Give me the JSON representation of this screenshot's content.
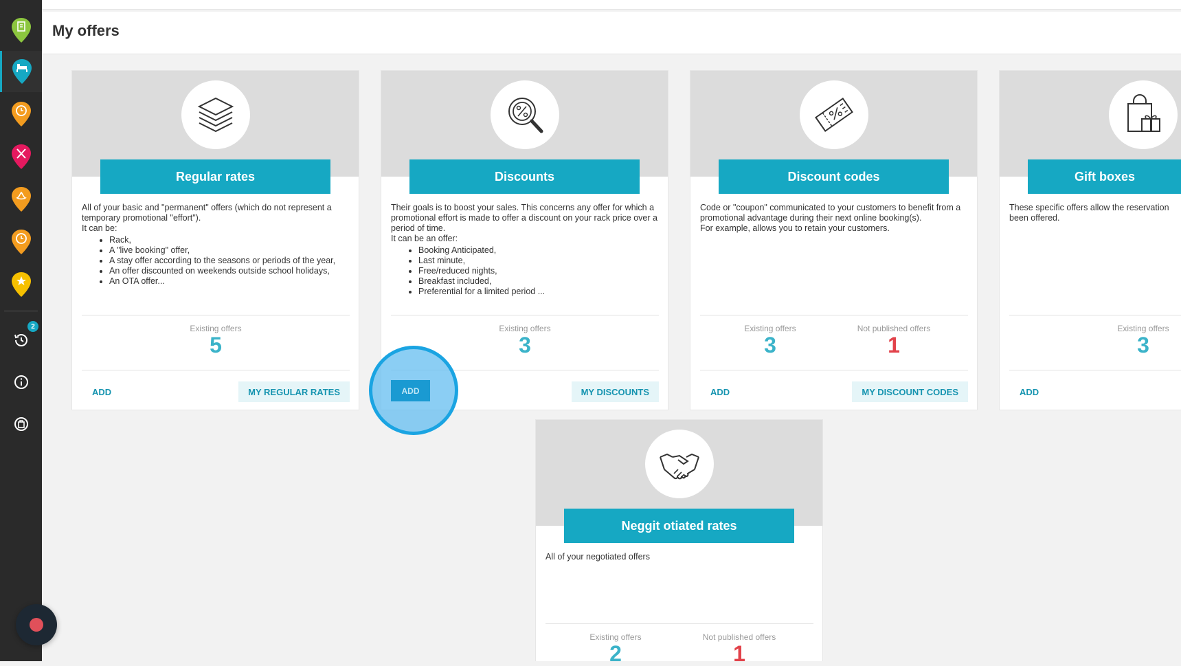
{
  "header": {
    "title": "My offers"
  },
  "sidebar": {
    "badge_count": "2",
    "colors": {
      "green": "#8cc63f",
      "teal": "#16a8c3",
      "orange": "#f39c1f",
      "pink": "#e5195f",
      "yellow": "#f6c000"
    }
  },
  "cards": [
    {
      "title": "Regular rates",
      "icon": "layers-icon",
      "desc_paragraphs": [
        "All of your basic and \"permanent\" offers (which do not represent a temporary promotional \"effort\").",
        "It can be:"
      ],
      "bullets": [
        "Rack,",
        "A \"live booking\" offer,",
        "A stay offer according to the seasons or periods of the year,",
        "An offer discounted on weekends outside school holidays,",
        "An OTA offer..."
      ],
      "stats": [
        {
          "label": "Existing offers",
          "value": "5"
        }
      ],
      "add_label": "ADD",
      "my_label": "MY REGULAR RATES"
    },
    {
      "title": "Discounts",
      "icon": "discount-search-icon",
      "desc_paragraphs": [
        "Their goals is to boost your sales. This concerns any offer for which a promotional effort is made to offer a discount on your rack price over a period of time.",
        "It can be an offer:"
      ],
      "bullets": [
        "Booking Anticipated,",
        "Last minute,",
        "Free/reduced nights,",
        "Breakfast included,",
        "Preferential for a limited period ..."
      ],
      "stats": [
        {
          "label": "Existing offers",
          "value": "3"
        }
      ],
      "add_label": "ADD",
      "my_label": "MY DISCOUNTS"
    },
    {
      "title": "Discount codes",
      "icon": "coupon-icon",
      "desc_paragraphs": [
        "Code or \"coupon\" communicated to your customers to benefit from a promotional advantage during their next online booking(s).",
        "For example, allows you to retain your customers."
      ],
      "bullets": [],
      "stats": [
        {
          "label": "Existing offers",
          "value": "3"
        },
        {
          "label": "Not published offers",
          "value": "1"
        }
      ],
      "add_label": "ADD",
      "my_label": "MY DISCOUNT CODES"
    },
    {
      "title": "Gift boxes",
      "icon": "gift-bag-icon",
      "desc_paragraphs": [
        "These specific offers allow the reservation",
        "been offered."
      ],
      "bullets": [],
      "stats": [
        {
          "label": "Existing offers",
          "value": "3"
        }
      ],
      "add_label": "ADD"
    },
    {
      "title": "Neggit otiated rates",
      "icon": "handshake-icon",
      "desc_paragraphs": [
        "All of your negotiated offers"
      ],
      "bullets": [],
      "stats": [
        {
          "label": "Existing offers",
          "value": "2"
        },
        {
          "label": "Not published offers",
          "value": "1"
        }
      ]
    }
  ]
}
